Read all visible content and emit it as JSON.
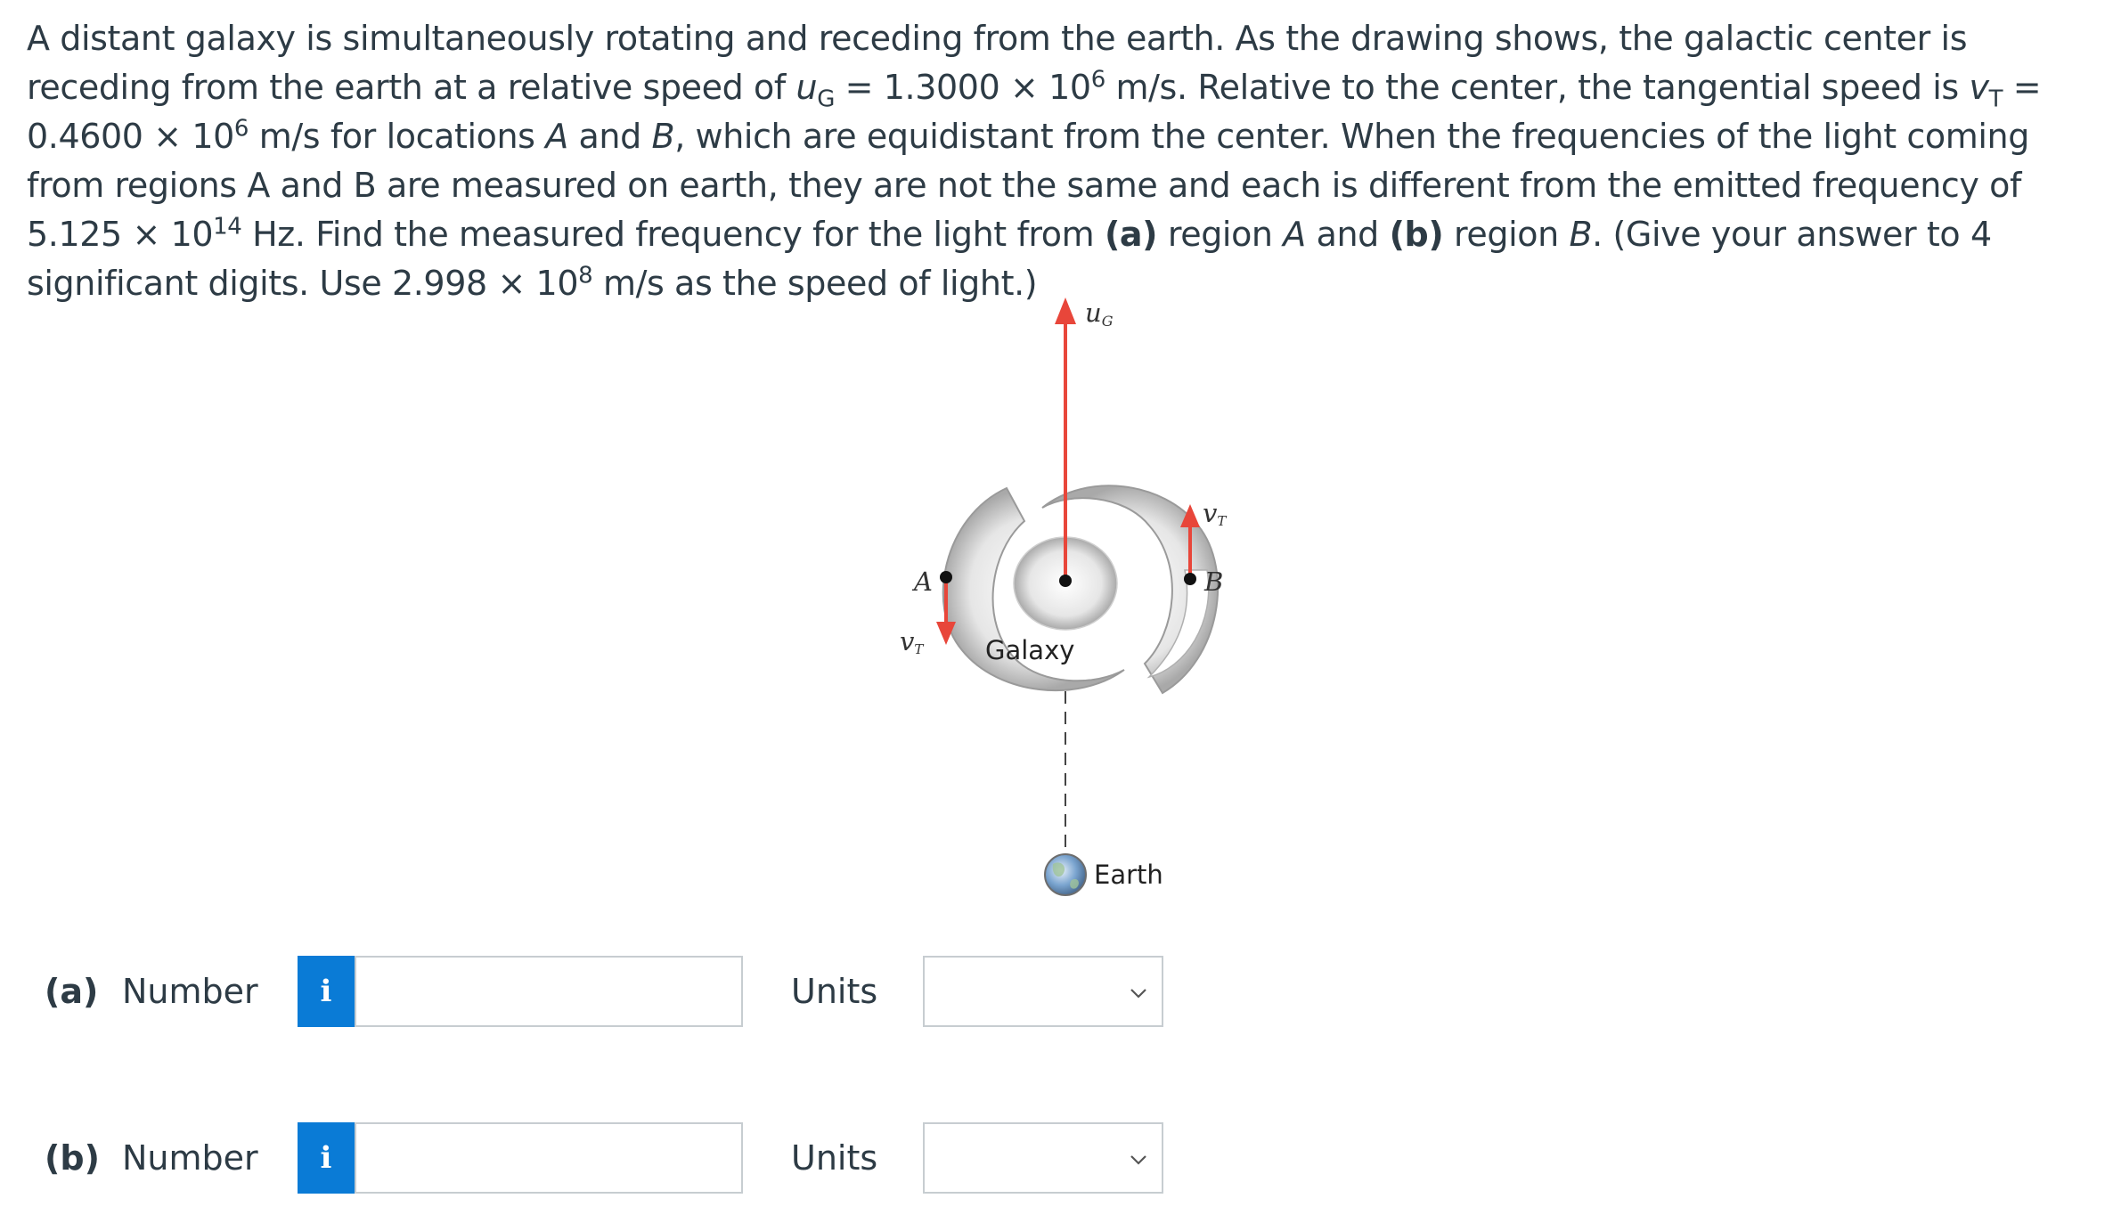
{
  "problem": {
    "p1": "A distant galaxy is simultaneously rotating and receding from the earth. As the drawing shows, the galactic center is receding from the earth at a relative speed of ",
    "uG_sym": "u",
    "uG_sub": "G",
    "p2": " = 1.3000 × 10",
    "exp6a": "6",
    "p3": " m/s. Relative to the center, the tangential speed is ",
    "vT_sym": "v",
    "vT_sub": "T",
    "p4": " = 0.4600 × 10",
    "exp6b": "6",
    "p5": " m/s for locations ",
    "A1": "A",
    "p6": " and ",
    "B1": "B",
    "p7": ", which are equidistant from the center. When the frequencies of the light coming from regions A and B are measured on earth, they are not the same and each is different from the emitted frequency of 5.125 × 10",
    "exp14": "14",
    "p8": " Hz. Find the measured frequency for the light from ",
    "a_tag": "(a)",
    "p9": " region ",
    "A2": "A",
    "p10": " and ",
    "b_tag": "(b)",
    "p11": " region ",
    "B2": "B",
    "p12": ". (Give your answer to 4 significant digits. Use 2.998 × 10",
    "exp8": "8",
    "p13": " m/s as the speed of light.)"
  },
  "figure": {
    "uG_label": "u",
    "uG_sub": "G",
    "vT_label": "v",
    "vT_sub": "T",
    "point_a": "A",
    "point_b": "B",
    "galaxy": "Galaxy",
    "earth": "Earth",
    "arrow_color": "#e8463a"
  },
  "answers": [
    {
      "part": "(a)",
      "number_label": "Number",
      "info": "i",
      "value": "",
      "units_label": "Units",
      "units_value": ""
    },
    {
      "part": "(b)",
      "number_label": "Number",
      "info": "i",
      "value": "",
      "units_label": "Units",
      "units_value": ""
    }
  ]
}
